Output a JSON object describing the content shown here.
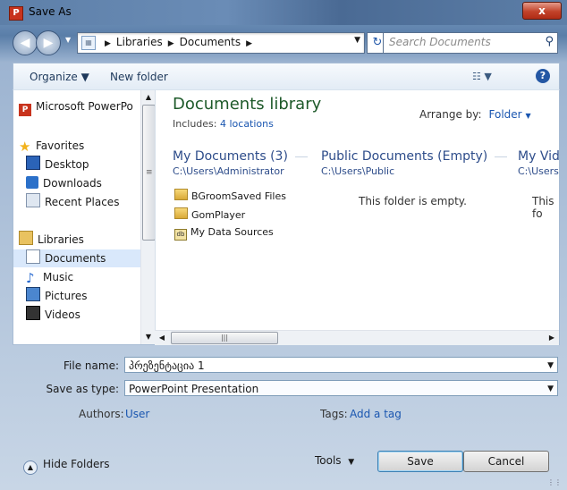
{
  "window": {
    "title": "Save As",
    "close_label": "x"
  },
  "address": {
    "crumbs": [
      "Libraries",
      "Documents"
    ],
    "search_placeholder": "Search Documents"
  },
  "toolbar": {
    "organize": "Organize",
    "new_folder": "New folder"
  },
  "nav": {
    "items": [
      {
        "label": "Microsoft PowerPo",
        "icon": "powerpoint-icon"
      },
      {
        "label": "Favorites",
        "icon": "star-icon"
      },
      {
        "label": "Desktop",
        "icon": "desktop-icon"
      },
      {
        "label": "Downloads",
        "icon": "downloads-icon"
      },
      {
        "label": "Recent Places",
        "icon": "recent-places-icon"
      },
      {
        "label": "Libraries",
        "icon": "libraries-icon"
      },
      {
        "label": "Documents",
        "icon": "documents-icon",
        "selected": true
      },
      {
        "label": "Music",
        "icon": "music-icon"
      },
      {
        "label": "Pictures",
        "icon": "pictures-icon"
      },
      {
        "label": "Videos",
        "icon": "videos-icon"
      }
    ]
  },
  "library": {
    "title": "Documents library",
    "includes_label": "Includes:",
    "includes_link": "4 locations",
    "arrange_label": "Arrange by:",
    "arrange_value": "Folder",
    "columns": [
      {
        "title": "My Documents (3)",
        "path": "C:\\Users\\Administrator"
      },
      {
        "title": "Public Documents (Empty)",
        "path": "C:\\Users\\Public"
      },
      {
        "title": "My Vide",
        "path": "C:\\Users\\"
      }
    ],
    "files": [
      "BGroomSaved Files",
      "GomPlayer",
      "My Data Sources"
    ],
    "empty_message": "This folder is empty.",
    "empty_message_partial": "This fo"
  },
  "form": {
    "file_name_label": "File name:",
    "file_name_value": "პრეზენტაცია 1",
    "save_type_label": "Save as type:",
    "save_type_value": "PowerPoint Presentation",
    "authors_label": "Authors:",
    "authors_value": "User",
    "tags_label": "Tags:",
    "tags_value": "Add a tag"
  },
  "footer": {
    "hide_folders": "Hide Folders",
    "tools": "Tools",
    "save": "Save",
    "cancel": "Cancel"
  },
  "colors": {
    "link": "#1a56b0",
    "library_title": "#1e5a2a",
    "column_title": "#2d4c8a"
  }
}
